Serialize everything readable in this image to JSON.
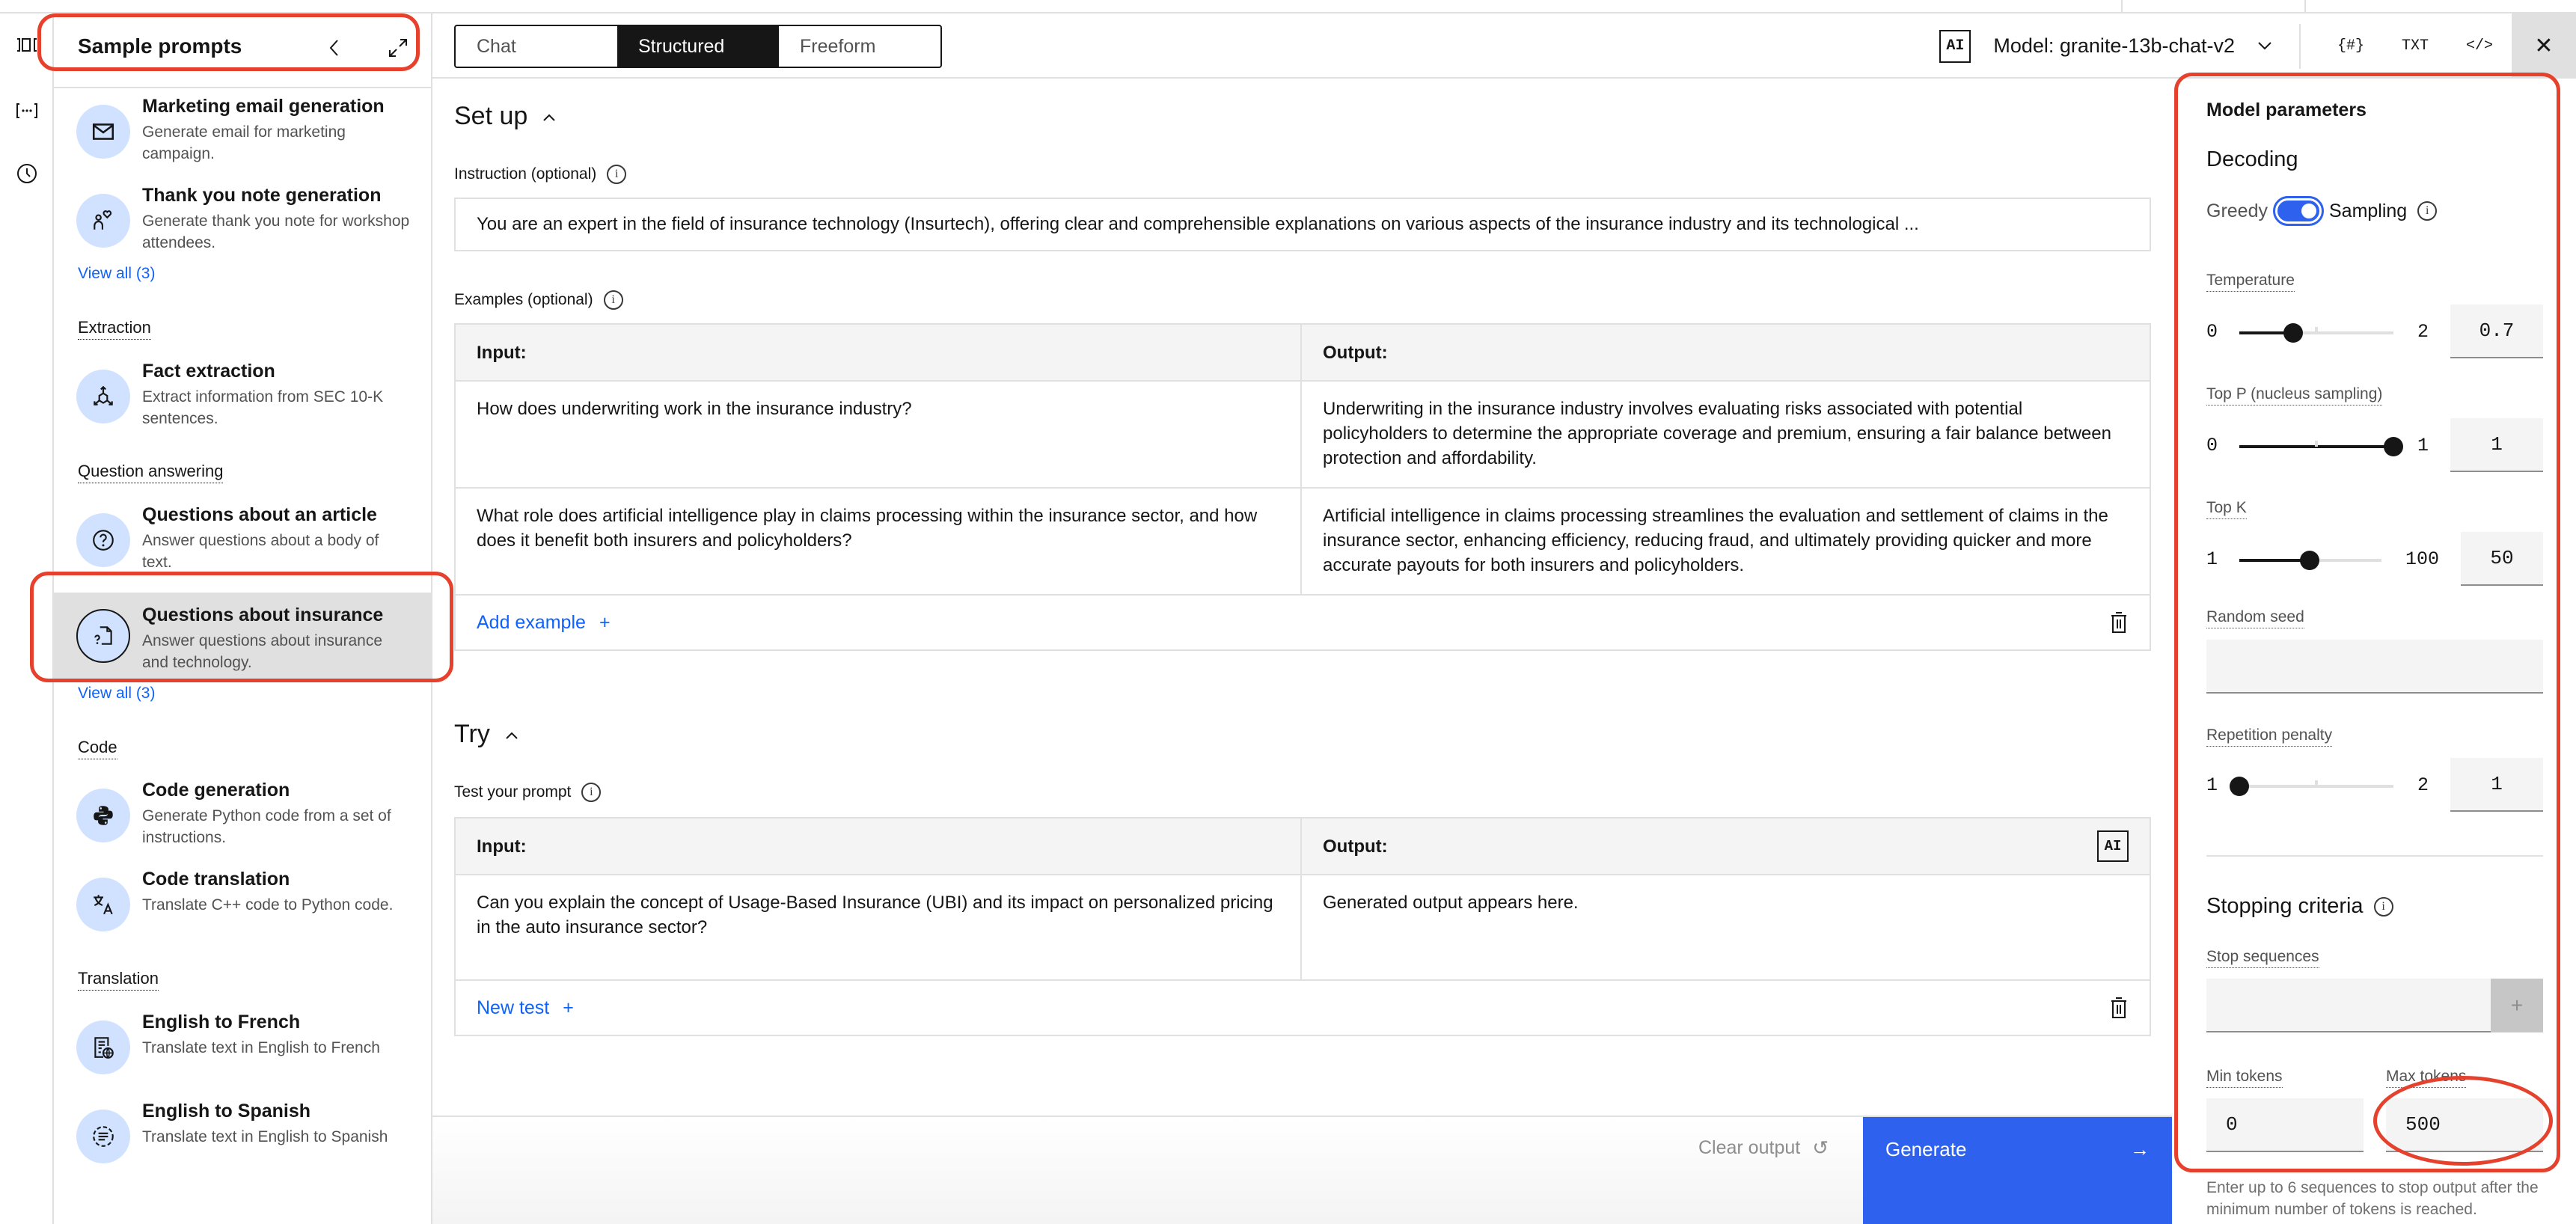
{
  "left_rail": {
    "icons": [
      {
        "name": "compare-icon",
        "glyph": "⧉"
      },
      {
        "name": "variables-icon",
        "glyph": "[⋯]"
      },
      {
        "name": "history-icon",
        "glyph": "◷"
      }
    ]
  },
  "samples_panel": {
    "title": "Sample prompts",
    "collapse_icon": "‹",
    "expand_icon": "⤢",
    "view_all_1": "View all (3)",
    "view_all_2": "View all (3)",
    "categories": {
      "extraction": "Extraction",
      "qa": "Question answering",
      "code": "Code",
      "translation": "Translation"
    },
    "items": [
      {
        "title": "Marketing email generation",
        "desc": "Generate email for marketing campaign.",
        "icon": "email-icon"
      },
      {
        "title": "Thank you note generation",
        "desc": "Generate thank you note for workshop attendees.",
        "icon": "thank-you-icon"
      },
      {
        "title": "Fact extraction",
        "desc": "Extract information from SEC 10-K sentences.",
        "icon": "extract-icon"
      },
      {
        "title": "Questions about an article",
        "desc": "Answer questions about a body of text.",
        "icon": "question-icon"
      },
      {
        "title": "Questions about insurance",
        "desc": "Answer questions about insurance and technology.",
        "icon": "document-question-icon",
        "selected": true
      },
      {
        "title": "Code generation",
        "desc": "Generate Python code from a set of instructions.",
        "icon": "python-icon"
      },
      {
        "title": "Code translation",
        "desc": "Translate C++ code to Python code.",
        "icon": "translate-icon"
      },
      {
        "title": "English to French",
        "desc": "Translate text in English to French",
        "icon": "document-globe-icon"
      },
      {
        "title": "English to Spanish",
        "desc": "Translate text in English to Spanish",
        "icon": "summary-icon"
      }
    ]
  },
  "toolbar": {
    "modes": [
      "Chat",
      "Structured",
      "Freeform"
    ],
    "active_mode": "Structured",
    "ai_badge": "AI",
    "model_label": "Model: granite-13b-chat-v2",
    "chevron": "⌄",
    "buttons": {
      "variables": "{#}",
      "txt": "TXT",
      "code": "</>",
      "close": "✕"
    }
  },
  "setup": {
    "title": "Set up",
    "caret": "^",
    "instruction_label": "Instruction (optional)",
    "instruction_value": "You are an expert in the field of insurance technology (Insurtech), offering clear and comprehensible explanations on various aspects of the insurance industry and its technological ...",
    "examples_label": "Examples (optional)",
    "input_header": "Input:",
    "output_header": "Output:",
    "examples": [
      {
        "input": "How does underwriting work in the insurance industry?",
        "output": "Underwriting in the insurance industry involves evaluating risks associated with potential policyholders to determine the appropriate coverage and premium, ensuring a fair balance between protection and affordability."
      },
      {
        "input": "What role does artificial intelligence play in claims processing within the insurance sector, and how does it benefit both insurers and policyholders?",
        "output": "Artificial intelligence in claims processing streamlines the evaluation and settlement of claims in the insurance sector, enhancing efficiency, reducing fraud, and ultimately providing quicker and more accurate payouts for both insurers and policyholders."
      }
    ],
    "add_example": "Add example",
    "plus": "+"
  },
  "try": {
    "title": "Try",
    "caret": "^",
    "test_label": "Test your prompt",
    "input_header": "Input:",
    "output_header": "Output:",
    "ai_badge": "AI",
    "test_input": "Can you explain the concept of Usage-Based Insurance (UBI) and its impact on personalized pricing in the auto insurance sector?",
    "output_placeholder": "Generated output appears here.",
    "new_test": "New test",
    "plus": "+"
  },
  "actions": {
    "clear_output": "Clear output",
    "clear_icon": "↺",
    "generate": "Generate",
    "generate_icon": "→",
    "generate_color": "#2d61ee"
  },
  "parameters": {
    "title": "Model parameters",
    "decoding_title": "Decoding",
    "greedy_label": "Greedy",
    "sampling_label": "Sampling",
    "sampling_enabled": true,
    "temperature": {
      "label": "Temperature",
      "min": "0",
      "max": "2",
      "value": "0.7",
      "fraction": 0.35
    },
    "top_p": {
      "label": "Top P (nucleus sampling)",
      "min": "0",
      "max": "1",
      "value": "1",
      "fraction": 1.0
    },
    "top_k": {
      "label": "Top K",
      "min": "1",
      "max": "100",
      "value": "50",
      "fraction": 0.495
    },
    "random_seed": {
      "label": "Random seed",
      "value": ""
    },
    "repetition_penalty": {
      "label": "Repetition penalty",
      "min": "1",
      "max": "2",
      "value": "1",
      "fraction": 0.0
    },
    "stopping_title": "Stopping criteria",
    "stop_sequences_label": "Stop sequences",
    "stop_add": "+",
    "min_tokens_label": "Min tokens",
    "min_tokens": "0",
    "max_tokens_label": "Max tokens",
    "max_tokens": "500",
    "helper_text": "Enter up to 6 sequences to stop output after the minimum number of tokens is reached."
  },
  "annotation_color": "#e5412d"
}
